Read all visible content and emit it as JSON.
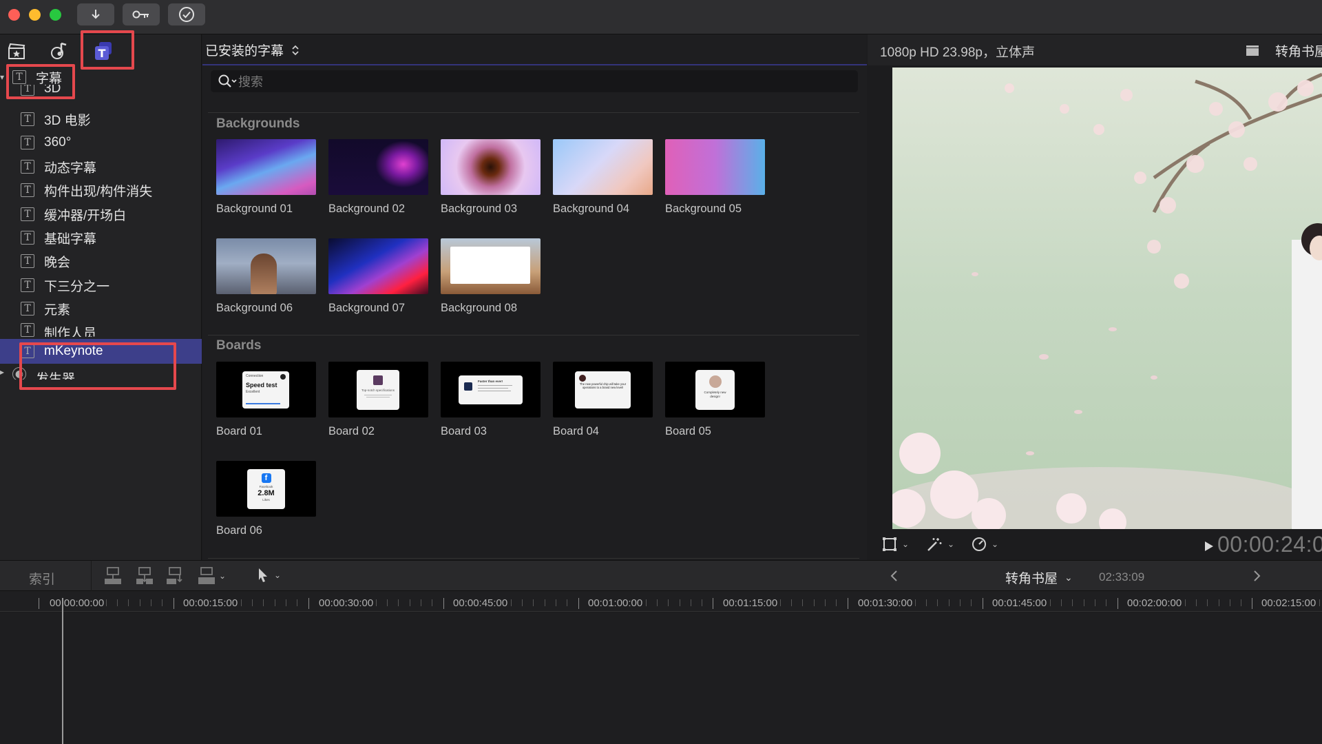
{
  "titlebar": {
    "import_icon": "down-arrow-icon",
    "keywords_icon": "key-icon",
    "background_tasks_icon": "checkmark-circle-icon"
  },
  "sidebar": {
    "tab_icons": [
      "clapperboard-star-icon",
      "music-photo-icon",
      "titles-icon"
    ],
    "items": [
      {
        "label": "字幕",
        "level": 0
      },
      {
        "label": "3D",
        "level": 1
      },
      {
        "label": "3D 电影",
        "level": 1
      },
      {
        "label": "360°",
        "level": 1
      },
      {
        "label": "动态字幕",
        "level": 1
      },
      {
        "label": "构件出现/构件消失",
        "level": 1
      },
      {
        "label": "缓冲器/开场白",
        "level": 1
      },
      {
        "label": "基础字幕",
        "level": 1
      },
      {
        "label": "晚会",
        "level": 1
      },
      {
        "label": "下三分之一",
        "level": 1
      },
      {
        "label": "元素",
        "level": 1
      },
      {
        "label": "制作人员",
        "level": 1
      },
      {
        "label": "mKeynote",
        "level": 1,
        "selected": true
      },
      {
        "label": "发生器",
        "level": 0
      }
    ]
  },
  "browser": {
    "header_title": "已安装的字幕",
    "search_placeholder": "搜索",
    "sections": [
      {
        "title": "Backgrounds",
        "items": [
          "Background 01",
          "Background 02",
          "Background 03",
          "Background 04",
          "Background 05",
          "Background 06",
          "Background 07",
          "Background 08"
        ]
      },
      {
        "title": "Boards",
        "items": [
          "Board 01",
          "Board 02",
          "Board 03",
          "Board 04",
          "Board 05",
          "Board 06"
        ]
      }
    ],
    "board_card_text": {
      "b1_small": "Connection",
      "b1_main": "Speed test",
      "b1_sub": "Excellent",
      "b2_text": "Top-notch specifications",
      "b3_text": "Faster than ever!",
      "b4_text": "The new powerful chip will take your operations to a brand new level!",
      "b5_text": "Completely new design!",
      "b6_small": "Facebook",
      "b6_main": "2.8M",
      "b6_sub": "Likes"
    }
  },
  "viewer": {
    "format_label": "1080p HD 23.98p，立体声",
    "project_name_truncated": "转角书屋",
    "timecode": "00:00:24:0"
  },
  "timeline": {
    "index_label": "索引",
    "project_name": "转角书屋",
    "duration": "02:33:09",
    "ruler_labels": [
      "00:00:00:00",
      "00:00:15:00",
      "00:00:30:00",
      "00:00:45:00",
      "00:01:00:00",
      "00:01:15:00",
      "00:01:30:00",
      "00:01:45:00",
      "00:02:00:00",
      "00:02:15:00"
    ]
  },
  "colors": {
    "selection": "#3d3f8a",
    "annotation": "#e5484d",
    "accent_purple": "#5b5bd6"
  }
}
